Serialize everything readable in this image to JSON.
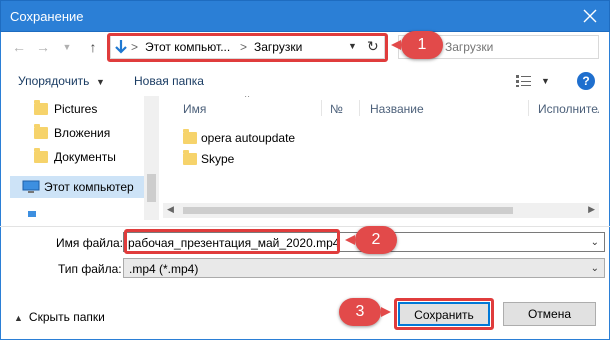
{
  "window": {
    "title": "Сохранение"
  },
  "address": {
    "path_1": "Этот компьют...",
    "path_2": "Загрузки"
  },
  "search": {
    "placeholder": "Загрузки"
  },
  "toolbar": {
    "organize_label": "Упорядочить",
    "new_folder_label": "Новая папка",
    "help_label": "?"
  },
  "tree": {
    "items": [
      {
        "label": "Pictures"
      },
      {
        "label": "Вложения"
      },
      {
        "label": "Документы"
      },
      {
        "label": "Этот компьютер"
      }
    ]
  },
  "file_list": {
    "columns": [
      {
        "label": "Имя"
      },
      {
        "label": "№"
      },
      {
        "label": "Название"
      },
      {
        "label": "Исполнители"
      }
    ],
    "items": [
      {
        "label": "opera autoupdate"
      },
      {
        "label": "Skype"
      }
    ]
  },
  "form": {
    "filename_label": "Имя файла:",
    "filename_value": "рабочая_презентация_май_2020.mp4",
    "filetype_label": "Тип файла:",
    "filetype_value": ".mp4 (*.mp4)"
  },
  "footer": {
    "hide_folders_label": "Скрыть папки",
    "save_label": "Сохранить",
    "cancel_label": "Отмена"
  },
  "annotations": {
    "badge_1": "1",
    "badge_2": "2",
    "badge_3": "3",
    "color": "#e24a4a"
  },
  "colors": {
    "titlebar": "#2b7fd6",
    "accent": "#0078d7",
    "selection": "#cde3f7"
  }
}
